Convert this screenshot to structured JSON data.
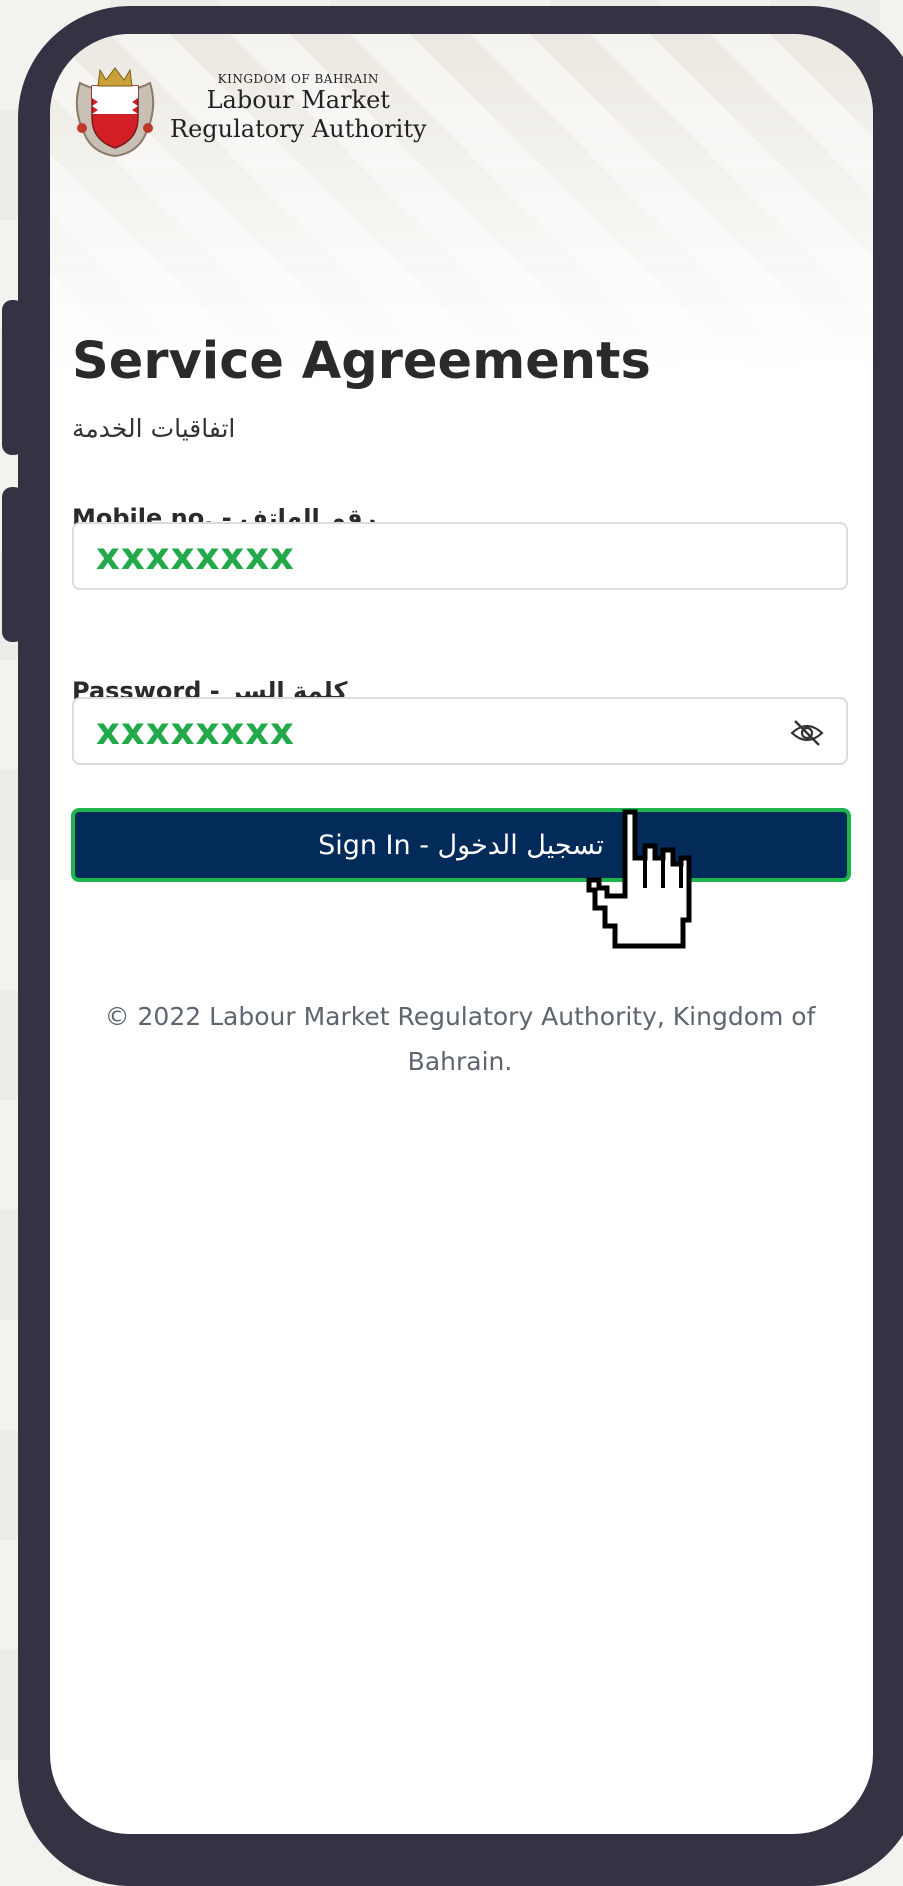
{
  "header": {
    "kingdom": "KINGDOM OF BAHRAIN",
    "authority_line1": "Labour Market",
    "authority_line2": "Regulatory Authority"
  },
  "page": {
    "title": "Service Agreements",
    "subtitle": "اتفاقيات الخدمة"
  },
  "form": {
    "mobile_label": "Mobile no. - رقم الهاتف",
    "mobile_value": "xxxxxxxx",
    "password_label": "Password - كلمة السر",
    "password_value": "xxxxxxxx",
    "signin_label": "Sign In - تسجيل الدخول"
  },
  "footer": {
    "copyright": "© 2022 Labour Market Regulatory Authority, Kingdom of Bahrain."
  },
  "icons": [
    "emblem-icon",
    "eye-slash-icon",
    "hand-cursor-icon"
  ],
  "colors": {
    "button_bg": "#022b5a",
    "button_border": "#1fb44e",
    "field_text": "#22a94a",
    "frame": "#353343"
  }
}
